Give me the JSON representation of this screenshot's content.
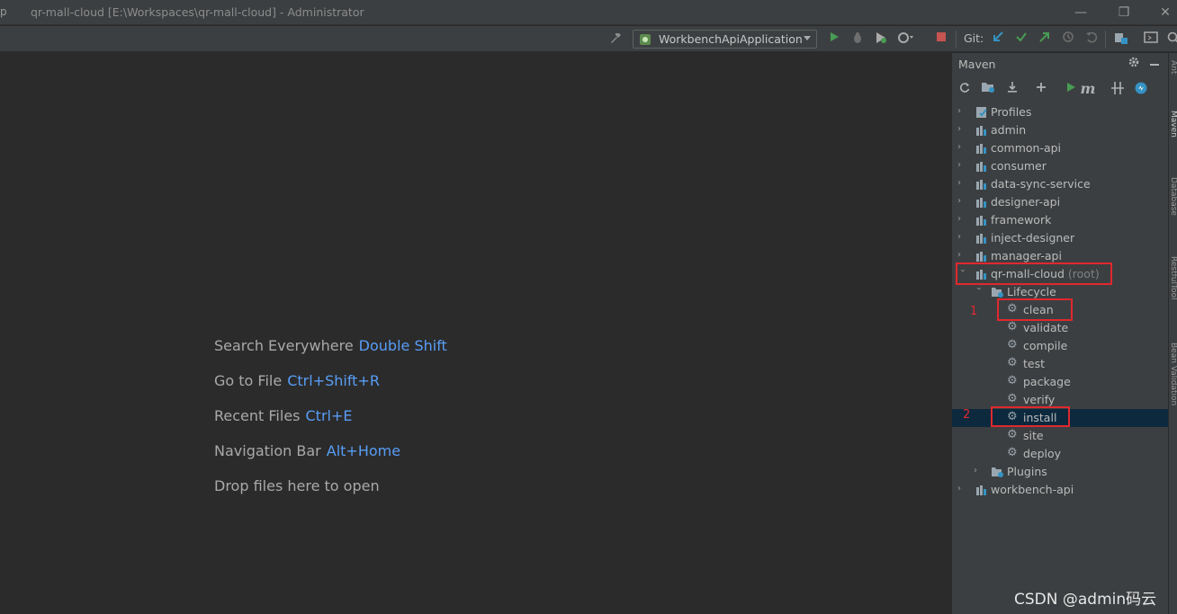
{
  "window": {
    "app_initial": "p",
    "title": "qr-mall-cloud [E:\\Workspaces\\qr-mall-cloud] - Administrator",
    "min_glyph": "—",
    "restore_glyph": "❐",
    "close_glyph": "✕"
  },
  "toolbar": {
    "run_config": "WorkbenchApiApplication",
    "git_label": "Git:"
  },
  "editor": {
    "hints": [
      {
        "label": "Search Everywhere",
        "key": "Double Shift"
      },
      {
        "label": "Go to File",
        "key": "Ctrl+Shift+R"
      },
      {
        "label": "Recent Files",
        "key": "Ctrl+E"
      },
      {
        "label": "Navigation Bar",
        "key": "Alt+Home"
      },
      {
        "label": "Drop files here to open",
        "key": ""
      }
    ]
  },
  "maven": {
    "title": "Maven",
    "tree": {
      "profiles": "Profiles",
      "modules_top": [
        "admin",
        "common-api",
        "consumer",
        "data-sync-service",
        "designer-api",
        "framework",
        "inject-designer",
        "manager-api"
      ],
      "root_module": "qr-mall-cloud",
      "root_tag": "(root)",
      "lifecycle": "Lifecycle",
      "phases": [
        "clean",
        "validate",
        "compile",
        "test",
        "package",
        "verify",
        "install",
        "site",
        "deploy"
      ],
      "plugins": "Plugins",
      "last_module": "workbench-api"
    },
    "annotations": {
      "first": "1",
      "second": "2"
    }
  },
  "side_tabs": [
    "Ant",
    "Maven",
    "Database",
    "RestfulTool",
    "Bean Validation"
  ],
  "watermark": "CSDN @admin码云",
  "colors": {
    "accent": "#589df6",
    "highlight_box": "#e0282e",
    "selected_row": "#0d293e",
    "run_green": "#499c54"
  }
}
